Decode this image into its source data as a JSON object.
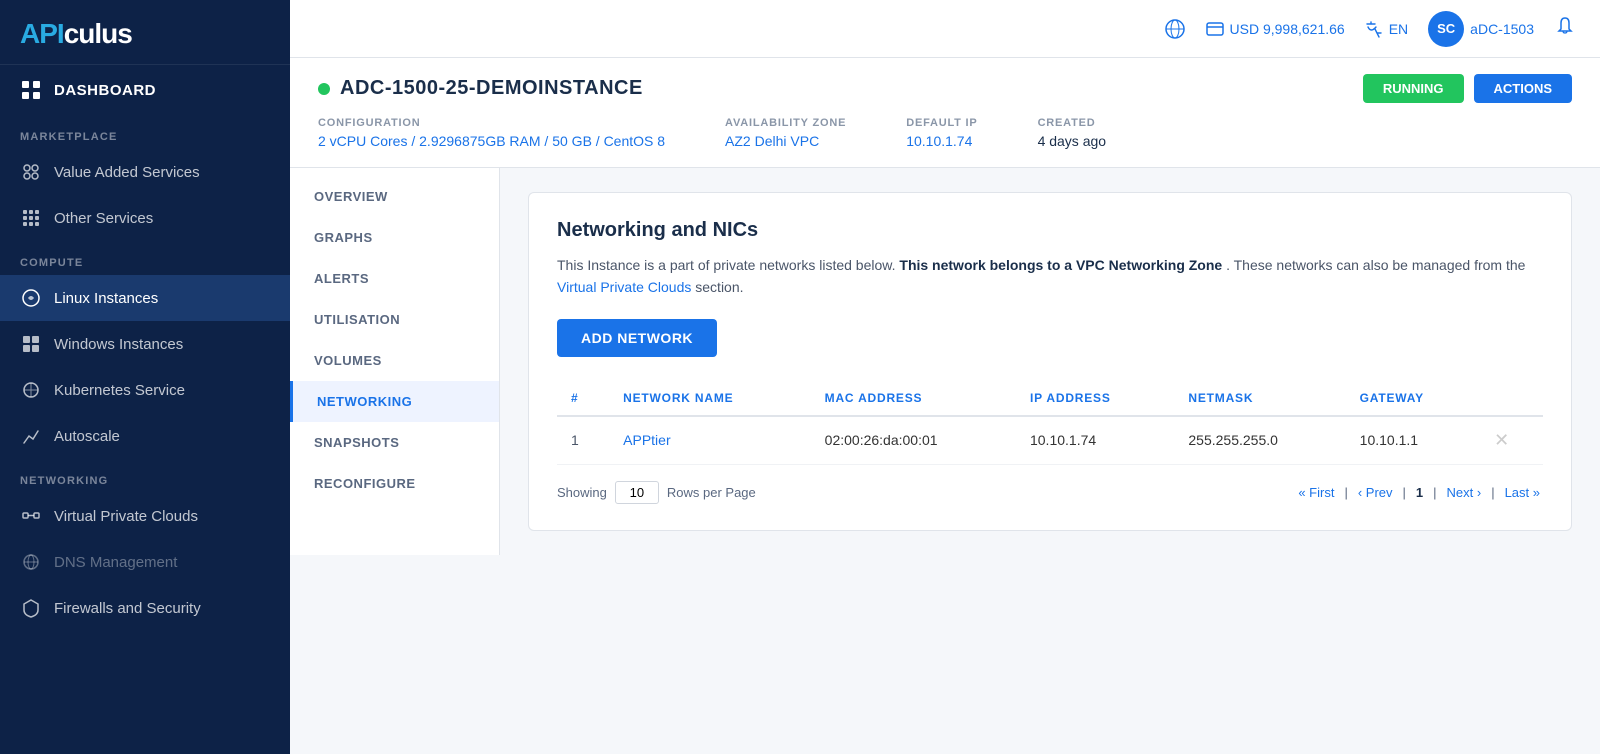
{
  "app": {
    "logo_prefix": "API",
    "logo_suffix": "culus"
  },
  "header": {
    "currency": "USD 9,998,621.66",
    "language": "EN",
    "avatar_initials": "SC",
    "username": "aDC-1503"
  },
  "sidebar": {
    "dashboard_label": "DASHBOARD",
    "sections": [
      {
        "label": "MARKETPLACE",
        "items": [
          {
            "id": "value-added-services",
            "label": "Value Added Services",
            "icon": "grid"
          },
          {
            "id": "other-services",
            "label": "Other Services",
            "icon": "dots-grid"
          }
        ]
      },
      {
        "label": "COMPUTE",
        "items": [
          {
            "id": "linux-instances",
            "label": "Linux Instances",
            "icon": "linux",
            "active": true
          },
          {
            "id": "windows-instances",
            "label": "Windows Instances",
            "icon": "windows"
          },
          {
            "id": "kubernetes-service",
            "label": "Kubernetes Service",
            "icon": "kubernetes"
          },
          {
            "id": "autoscale",
            "label": "Autoscale",
            "icon": "autoscale"
          }
        ]
      },
      {
        "label": "NETWORKING",
        "items": [
          {
            "id": "virtual-private-clouds",
            "label": "Virtual Private Clouds",
            "icon": "vpc"
          },
          {
            "id": "dns-management",
            "label": "DNS Management",
            "icon": "dns",
            "disabled": true
          },
          {
            "id": "firewalls-and-security",
            "label": "Firewalls and Security",
            "icon": "firewall"
          }
        ]
      }
    ]
  },
  "instance": {
    "name": "ADC-1500-25-DEMOINSTANCE",
    "status": "running",
    "config": "2 vCPU Cores / 2.9296875GB RAM / 50 GB / CentOS 8",
    "availability_zone": "AZ2 Delhi VPC",
    "default_ip": "10.10.1.74",
    "created": "4 days ago"
  },
  "left_nav": {
    "items": [
      {
        "id": "overview",
        "label": "OVERVIEW"
      },
      {
        "id": "graphs",
        "label": "GRAPHS"
      },
      {
        "id": "alerts",
        "label": "ALERTS"
      },
      {
        "id": "utilisation",
        "label": "UTILISATION"
      },
      {
        "id": "volumes",
        "label": "VOLUMES"
      },
      {
        "id": "networking",
        "label": "NETWORKING",
        "active": true
      },
      {
        "id": "snapshots",
        "label": "SNAPSHOTS"
      },
      {
        "id": "reconfigure",
        "label": "RECONFIGURE"
      }
    ]
  },
  "networking_panel": {
    "title": "Networking and NICs",
    "description_part1": "This Instance is a part of private networks listed below.",
    "description_bold": "This network belongs to a VPC Networking Zone",
    "description_part2": ". These networks can also be managed from the ",
    "vpc_link_text": "Virtual Private Clouds",
    "description_part3": " section.",
    "add_network_label": "ADD NETWORK",
    "table": {
      "columns": [
        "#",
        "NETWORK NAME",
        "MAC ADDRESS",
        "IP ADDRESS",
        "NETMASK",
        "GATEWAY"
      ],
      "rows": [
        {
          "num": "1",
          "network_name": "APPtier",
          "mac_address": "02:00:26:da:00:01",
          "ip_address": "10.10.1.74",
          "netmask": "255.255.255.0",
          "gateway": "10.10.1.1"
        }
      ]
    },
    "pagination": {
      "showing_label": "Showing",
      "rows_per_page_value": "10",
      "rows_per_page_label": "Rows per Page",
      "first": "« First",
      "prev": "‹ Prev",
      "current_page": "1",
      "next": "Next ›",
      "last": "Last »"
    }
  },
  "meta_labels": {
    "configuration": "CONFIGURATION",
    "availability_zone": "AVAILABILITY ZONE",
    "default_ip": "DEFAULT IP",
    "created": "CREATED"
  }
}
